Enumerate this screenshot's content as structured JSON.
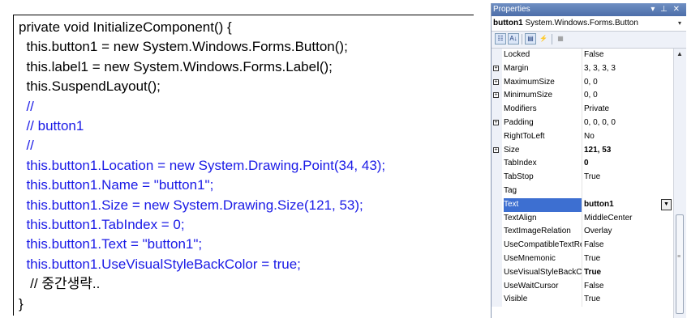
{
  "code": {
    "lines": [
      {
        "text": "private void InitializeComponent() {",
        "blue": false
      },
      {
        "text": "  this.button1 = new System.Windows.Forms.Button();",
        "blue": false
      },
      {
        "text": "  this.label1 = new System.Windows.Forms.Label();",
        "blue": false
      },
      {
        "text": "  this.SuspendLayout();",
        "blue": false
      },
      {
        "text": "  //",
        "blue": true
      },
      {
        "text": "  // button1",
        "blue": true
      },
      {
        "text": "  //",
        "blue": true
      },
      {
        "text": "  this.button1.Location = new System.Drawing.Point(34, 43);",
        "blue": true
      },
      {
        "text": "  this.button1.Name = \"button1\";",
        "blue": true
      },
      {
        "text": "  this.button1.Size = new System.Drawing.Size(121, 53);",
        "blue": true
      },
      {
        "text": "  this.button1.TabIndex = 0;",
        "blue": true
      },
      {
        "text": "  this.button1.Text = \"button1\";",
        "blue": true
      },
      {
        "text": "  this.button1.UseVisualStyleBackColor = true;",
        "blue": true
      },
      {
        "text": "   // 중간생략..",
        "blue": false
      },
      {
        "text": "}",
        "blue": false
      }
    ]
  },
  "properties": {
    "title": "Properties",
    "title_controls": "▾ ⊥ ✕",
    "object_name": "button1",
    "object_type": "System.Windows.Forms.Button",
    "toolbar_icons": [
      "categorized-icon",
      "alphabetical-icon",
      "properties-icon",
      "events-icon",
      "property-pages-icon"
    ],
    "rows": [
      {
        "name": "Locked",
        "value": "False",
        "expandable": false,
        "bold": false,
        "selected": false
      },
      {
        "name": "Margin",
        "value": "3, 3, 3, 3",
        "expandable": true,
        "bold": false,
        "selected": false
      },
      {
        "name": "MaximumSize",
        "value": "0, 0",
        "expandable": true,
        "bold": false,
        "selected": false
      },
      {
        "name": "MinimumSize",
        "value": "0, 0",
        "expandable": true,
        "bold": false,
        "selected": false
      },
      {
        "name": "Modifiers",
        "value": "Private",
        "expandable": false,
        "bold": false,
        "selected": false
      },
      {
        "name": "Padding",
        "value": "0, 0, 0, 0",
        "expandable": true,
        "bold": false,
        "selected": false
      },
      {
        "name": "RightToLeft",
        "value": "No",
        "expandable": false,
        "bold": false,
        "selected": false
      },
      {
        "name": "Size",
        "value": "121, 53",
        "expandable": true,
        "bold": true,
        "selected": false
      },
      {
        "name": "TabIndex",
        "value": "0",
        "expandable": false,
        "bold": true,
        "selected": false
      },
      {
        "name": "TabStop",
        "value": "True",
        "expandable": false,
        "bold": false,
        "selected": false
      },
      {
        "name": "Tag",
        "value": "",
        "expandable": false,
        "bold": false,
        "selected": false
      },
      {
        "name": "Text",
        "value": "button1",
        "expandable": false,
        "bold": true,
        "selected": true
      },
      {
        "name": "TextAlign",
        "value": "MiddleCenter",
        "expandable": false,
        "bold": false,
        "selected": false
      },
      {
        "name": "TextImageRelation",
        "value": "Overlay",
        "expandable": false,
        "bold": false,
        "selected": false
      },
      {
        "name": "UseCompatibleTextRe",
        "value": "False",
        "expandable": false,
        "bold": false,
        "selected": false
      },
      {
        "name": "UseMnemonic",
        "value": "True",
        "expandable": false,
        "bold": false,
        "selected": false
      },
      {
        "name": "UseVisualStyleBackCo",
        "value": "True",
        "expandable": false,
        "bold": true,
        "selected": false
      },
      {
        "name": "UseWaitCursor",
        "value": "False",
        "expandable": false,
        "bold": false,
        "selected": false
      },
      {
        "name": "Visible",
        "value": "True",
        "expandable": false,
        "bold": false,
        "selected": false
      }
    ]
  },
  "colors": {
    "code_comment_blue": "#1a1ae6",
    "selection_blue": "#3d6fd1",
    "title_bar": "#5b7db6"
  }
}
